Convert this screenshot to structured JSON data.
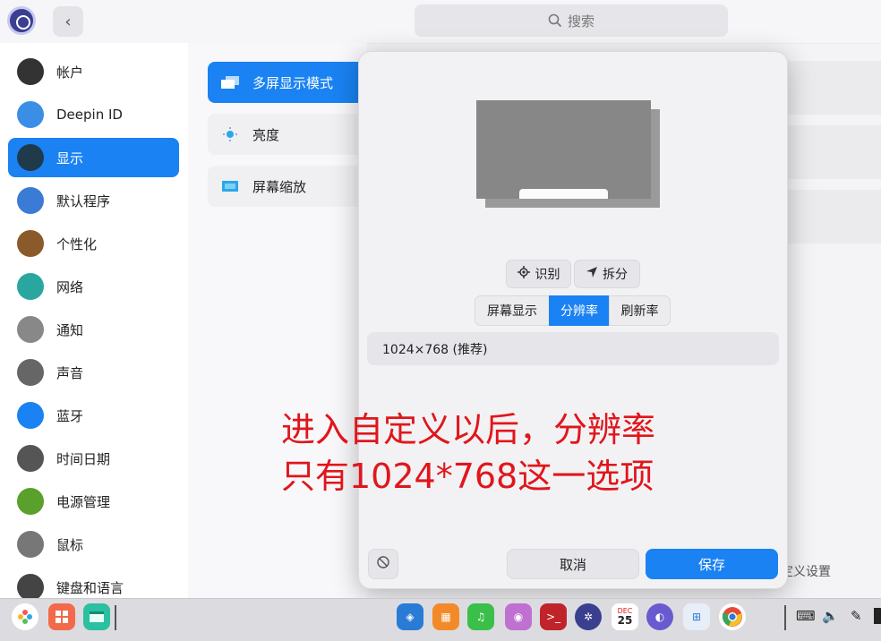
{
  "titlebar": {
    "search_placeholder": "搜索",
    "back_glyph": "‹"
  },
  "sidebar": {
    "items": [
      {
        "label": "帐户",
        "icon": "user-icon",
        "color": "#333333"
      },
      {
        "label": "Deepin ID",
        "icon": "cloud-icon",
        "color": "#3a8ee6"
      },
      {
        "label": "显示",
        "icon": "monitor-icon",
        "color": "#1f3a4a",
        "active": true
      },
      {
        "label": "默认程序",
        "icon": "default-apps-icon",
        "color": "#3a7bd5"
      },
      {
        "label": "个性化",
        "icon": "palette-icon",
        "color": "#8a5a2a"
      },
      {
        "label": "网络",
        "icon": "network-icon",
        "color": "#2aa6a0"
      },
      {
        "label": "通知",
        "icon": "bell-icon",
        "color": "#888888"
      },
      {
        "label": "声音",
        "icon": "speaker-icon",
        "color": "#666666"
      },
      {
        "label": "蓝牙",
        "icon": "bluetooth-icon",
        "color": "#1a82f2"
      },
      {
        "label": "时间日期",
        "icon": "clock-icon",
        "color": "#555555"
      },
      {
        "label": "电源管理",
        "icon": "battery-icon",
        "color": "#5aa02c"
      },
      {
        "label": "鼠标",
        "icon": "mouse-icon",
        "color": "#777777"
      },
      {
        "label": "键盘和语言",
        "icon": "keyboard-icon",
        "color": "#444444"
      }
    ]
  },
  "display_menu": {
    "items": [
      {
        "label": "多屏显示模式",
        "icon": "multi-screen-icon",
        "active": true
      },
      {
        "label": "亮度",
        "icon": "brightness-icon"
      },
      {
        "label": "屏幕缩放",
        "icon": "scale-icon"
      }
    ]
  },
  "dialog": {
    "identify_label": "识别",
    "split_label": "拆分",
    "tabs": [
      "屏幕显示",
      "分辨率",
      "刷新率"
    ],
    "active_tab": "分辨率",
    "resolution_option": "1024×768 (推荐)",
    "cancel_label": "取消",
    "save_label": "保存"
  },
  "annotation": {
    "line1": "进入自定义以后，分辨率",
    "line2": "只有1024*768这一选项",
    "color": "#e0161c"
  },
  "background_right": {
    "custom_settings_label": "定义设置"
  },
  "taskbar": {
    "calendar_month": "DEC",
    "calendar_day": "25",
    "accent": "#1a82f2"
  }
}
